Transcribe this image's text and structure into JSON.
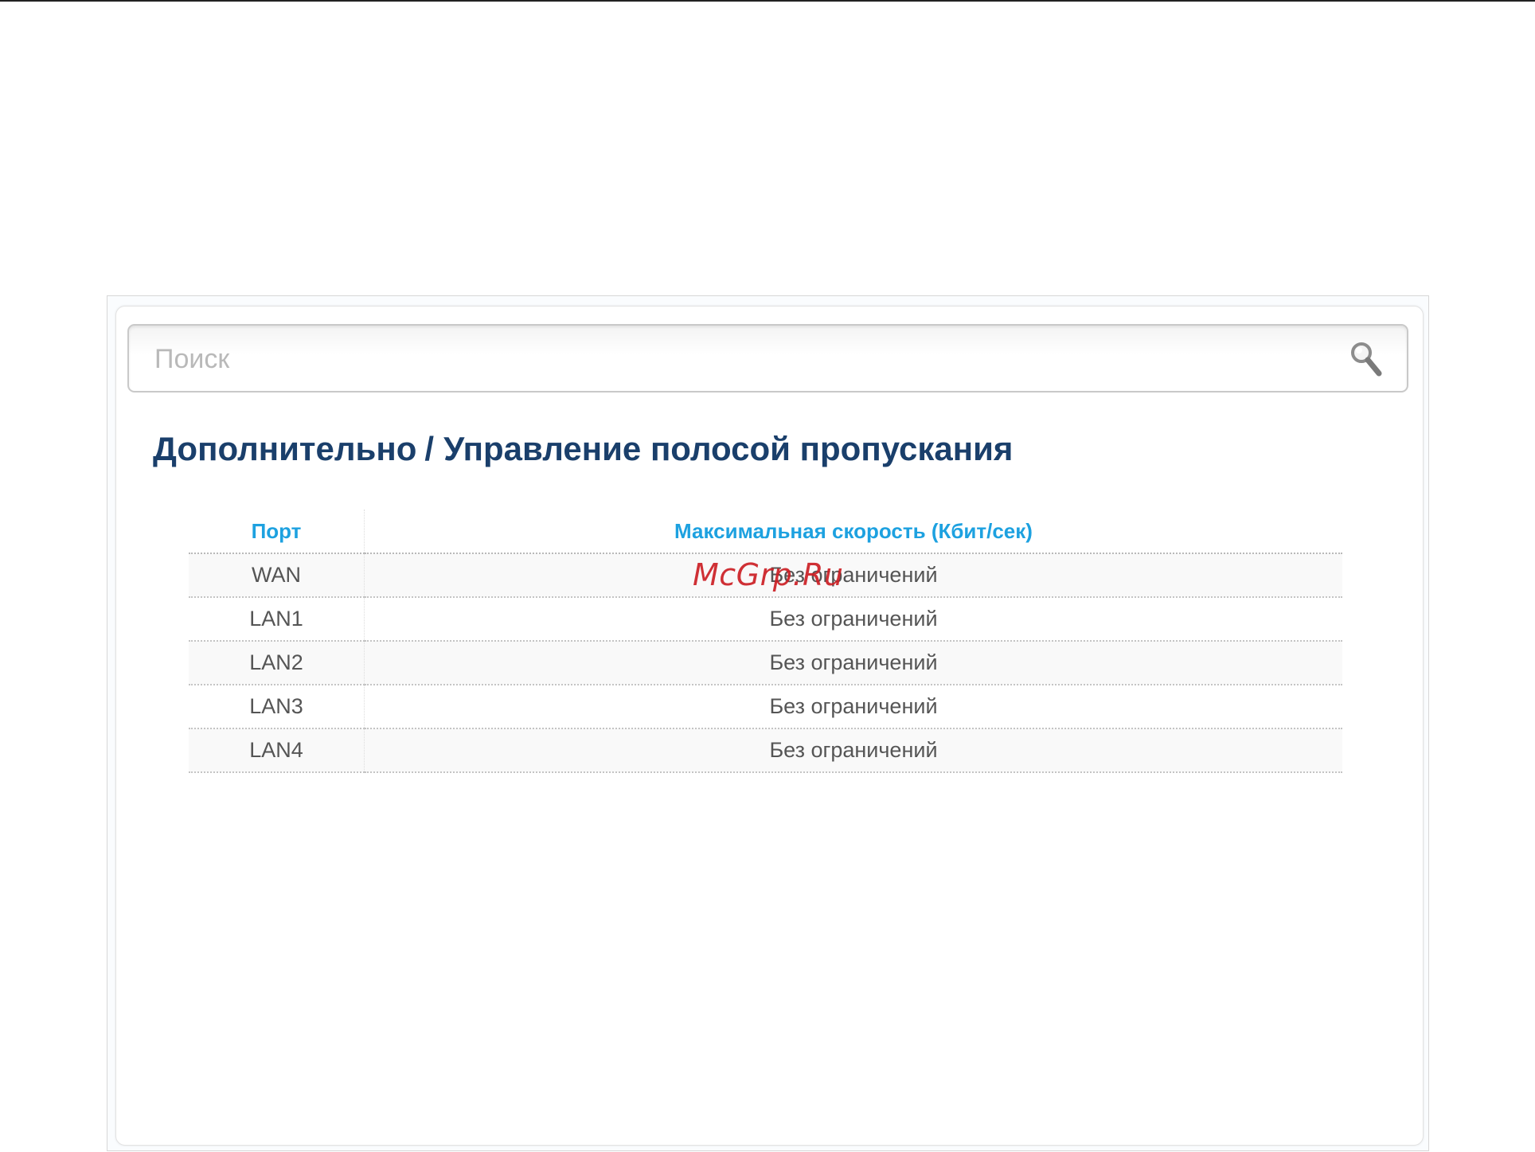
{
  "search": {
    "placeholder": "Поиск",
    "value": ""
  },
  "breadcrumb": {
    "section": "Дополнительно",
    "separator": "/",
    "page": "Управление полосой пропускания"
  },
  "table": {
    "columns": [
      "Порт",
      "Максимальная скорость (Кбит/сек)"
    ],
    "rows": [
      {
        "port": "WAN",
        "max_speed": "Без ограничений"
      },
      {
        "port": "LAN1",
        "max_speed": "Без ограничений"
      },
      {
        "port": "LAN2",
        "max_speed": "Без ограничений"
      },
      {
        "port": "LAN3",
        "max_speed": "Без ограничений"
      },
      {
        "port": "LAN4",
        "max_speed": "Без ограничений"
      }
    ]
  },
  "watermark": "McGrp.Ru",
  "colors": {
    "title": "#1a3f6b",
    "table_header": "#1da1e0",
    "cell_text": "#555555",
    "watermark": "#cc1f25"
  },
  "icons": {
    "search": "search-icon"
  }
}
